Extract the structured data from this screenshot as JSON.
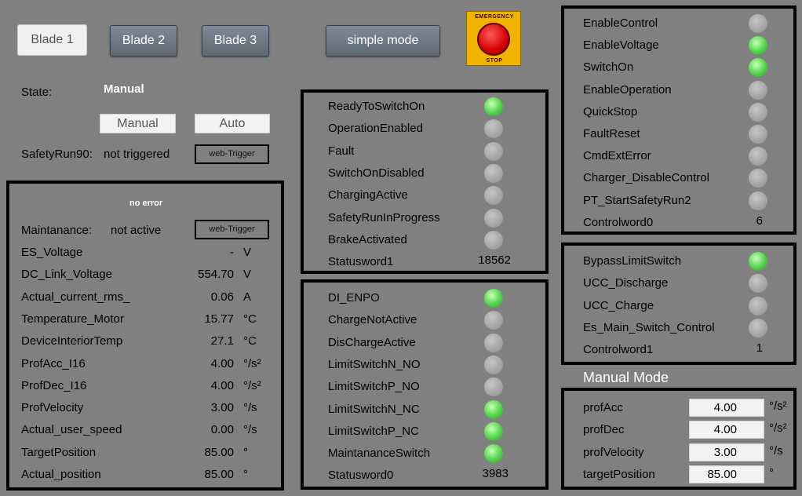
{
  "header": {
    "blade_tabs": [
      {
        "label": "Blade 1",
        "active": true
      },
      {
        "label": "Blade 2",
        "active": false
      },
      {
        "label": "Blade 3",
        "active": false
      }
    ],
    "simple_mode_label": "simple mode",
    "emergency_stop": {
      "top_text": "EMERGENCY",
      "bottom_text": "STOP"
    }
  },
  "state": {
    "label": "State:",
    "value": "Manual",
    "manual_button": "Manual",
    "auto_button": "Auto",
    "safety_label": "SafetyRun90:",
    "safety_value": "not triggered",
    "web_trigger_label": "web-Trigger"
  },
  "left_panel": {
    "error_text": "no error",
    "maintenance_label": "Maintanance:",
    "maintenance_value": "not active",
    "web_trigger_label": "web-Trigger",
    "rows": [
      {
        "label": "ES_Voltage",
        "value": "-",
        "unit": "V"
      },
      {
        "label": "DC_Link_Voltage",
        "value": "554.70",
        "unit": "V"
      },
      {
        "label": "Actual_current_rms_",
        "value": "0.06",
        "unit": "A"
      },
      {
        "label": "Temperature_Motor",
        "value": "15.77",
        "unit": "°C"
      },
      {
        "label": "DeviceInteriorTemp",
        "value": "27.1",
        "unit": "°C"
      },
      {
        "label": "ProfAcc_I16",
        "value": "4.00",
        "unit": "°/s²"
      },
      {
        "label": "ProfDec_I16",
        "value": "4.00",
        "unit": "°/s²"
      },
      {
        "label": "ProfVelocity",
        "value": "3.00",
        "unit": "°/s"
      },
      {
        "label": "Actual_user_speed",
        "value": "0.00",
        "unit": "°/s"
      },
      {
        "label": "TargetPosition",
        "value": "85.00",
        "unit": "°"
      },
      {
        "label": "Actual_position",
        "value": "85.00",
        "unit": "°"
      }
    ]
  },
  "status_panel1": {
    "items": [
      {
        "label": "ReadyToSwitchOn",
        "on": true
      },
      {
        "label": "OperationEnabled",
        "on": false
      },
      {
        "label": "Fault",
        "on": false
      },
      {
        "label": "SwitchOnDisabled",
        "on": false
      },
      {
        "label": "ChargingActive",
        "on": false
      },
      {
        "label": "SafetyRunInProgress",
        "on": false
      },
      {
        "label": "BrakeActivated",
        "on": false
      }
    ],
    "word_label": "Statusword1",
    "word_value": "18562"
  },
  "status_panel0": {
    "items": [
      {
        "label": "DI_ENPO",
        "on": true
      },
      {
        "label": "ChargeNotActive",
        "on": false
      },
      {
        "label": "DisChargeActive",
        "on": false
      },
      {
        "label": "LimitSwitchN_NO",
        "on": false
      },
      {
        "label": "LimitSwitchP_NO",
        "on": false
      },
      {
        "label": "LimitSwitchN_NC",
        "on": true
      },
      {
        "label": "LimitSwitchP_NC",
        "on": true
      },
      {
        "label": "MaintananceSwitch",
        "on": true
      }
    ],
    "word_label": "Statusword0",
    "word_value": "3983"
  },
  "control_panel0": {
    "items": [
      {
        "label": "EnableControl",
        "on": false
      },
      {
        "label": "EnableVoltage",
        "on": true
      },
      {
        "label": "SwitchOn",
        "on": true
      },
      {
        "label": "EnableOperation",
        "on": false
      },
      {
        "label": "QuickStop",
        "on": false
      },
      {
        "label": "FaultReset",
        "on": false
      },
      {
        "label": "CmdExtError",
        "on": false
      },
      {
        "label": "Charger_DisableControl",
        "on": false
      },
      {
        "label": "PT_StartSafetyRun2",
        "on": false
      }
    ],
    "word_label": "Controlword0",
    "word_value": "6"
  },
  "control_panel1": {
    "items": [
      {
        "label": "BypassLimitSwitch",
        "on": true
      },
      {
        "label": "UCC_Discharge",
        "on": false
      },
      {
        "label": "UCC_Charge",
        "on": false
      },
      {
        "label": "Es_Main_Switch_Control",
        "on": false
      }
    ],
    "word_label": "Controlword1",
    "word_value": "1"
  },
  "manual_mode": {
    "title": "Manual Mode",
    "rows": [
      {
        "label": "profAcc",
        "value": "4.00",
        "unit": "°/s²"
      },
      {
        "label": "profDec",
        "value": "4.00",
        "unit": "°/s²"
      },
      {
        "label": "profVelocity",
        "value": "3.00",
        "unit": "°/s"
      },
      {
        "label": "targetPosition",
        "value": "85.00",
        "unit": "°"
      }
    ]
  },
  "colors": {
    "background": "#808080",
    "led_on": "#52d24a",
    "led_off": "#a3a3a3",
    "panel_border": "#000000",
    "estop_yellow": "#f0b400",
    "estop_red": "#d40000"
  }
}
